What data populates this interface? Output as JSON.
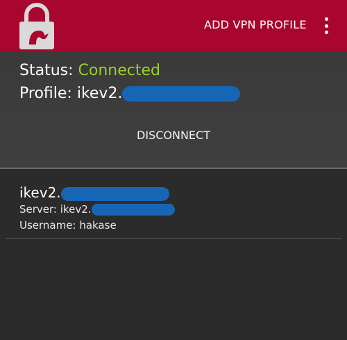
{
  "appbar": {
    "logo_icon": "padlock-strongswan-logo-icon",
    "add_profile_label": "ADD VPN PROFILE",
    "menu_icon": "overflow-menu-icon",
    "color": "#a8062e"
  },
  "status": {
    "status_label": "Status:",
    "status_value": "Connected",
    "status_color": "#9bd02b",
    "profile_label": "Profile:",
    "profile_value": "ikev2.",
    "disconnect_label": "DISCONNECT"
  },
  "profiles": [
    {
      "name": "ikev2.",
      "server_label": "Server:",
      "server_value": "ikev2.",
      "username_label": "Username:",
      "username_value": "hakase"
    }
  ],
  "redaction_color": "#1766b5"
}
